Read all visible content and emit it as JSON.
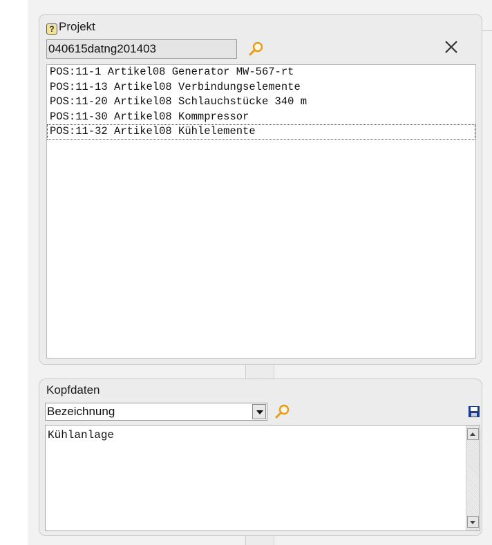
{
  "projekt": {
    "title": "Projekt",
    "project_value": "040615datng201403",
    "items": [
      {
        "label": "POS:11-1 Artikel08 Generator MW-567-rt"
      },
      {
        "label": "POS:11-13 Artikel08 Verbindungselemente"
      },
      {
        "label": "POS:11-20 Artikel08 Schlauchstücke 340 m"
      },
      {
        "label": "POS:11-30 Artikel08 Kommpressor"
      },
      {
        "label": "POS:11-32 Artikel08 Kühlelemente"
      }
    ],
    "selected_index": 4
  },
  "kopfdaten": {
    "title": "Kopfdaten",
    "field_select_value": "Bezeichnung",
    "text_value": "Kühlanlage"
  },
  "icons": {
    "help": "help-icon",
    "search": "search-icon",
    "close": "close-icon",
    "save": "save-icon",
    "dropdown": "chevron-down-icon"
  },
  "colors": {
    "panel_bg": "#ececec",
    "search_icon": "#f0a020",
    "save_icon": "#1e3c8c"
  }
}
